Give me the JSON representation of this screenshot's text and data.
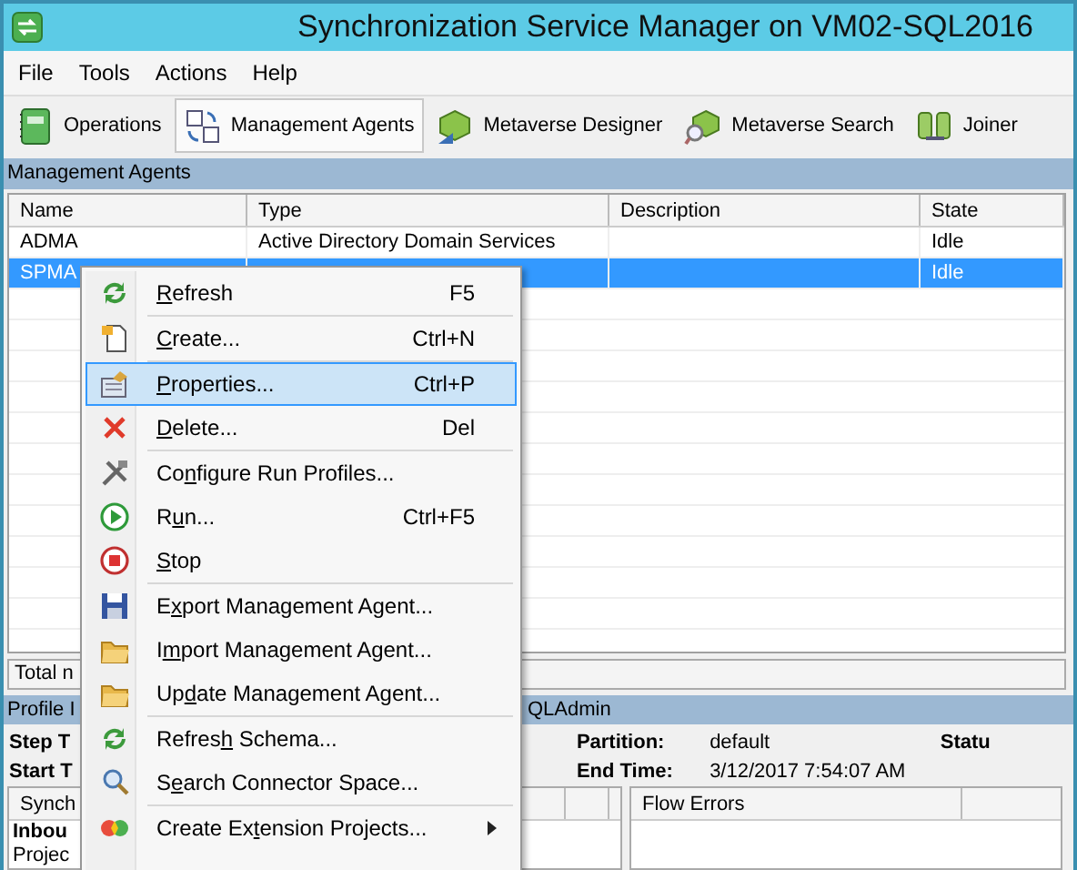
{
  "window": {
    "title": "Synchronization Service Manager on VM02-SQL2016"
  },
  "menu_bar": [
    {
      "label": "File"
    },
    {
      "label": "Tools"
    },
    {
      "label": "Actions"
    },
    {
      "label": "Help"
    }
  ],
  "toolbar": [
    {
      "kind": "operations",
      "label": "Operations",
      "selected": false
    },
    {
      "kind": "agents",
      "label": "Management Agents",
      "selected": true
    },
    {
      "kind": "designer",
      "label": "Metaverse Designer",
      "selected": false
    },
    {
      "kind": "search",
      "label": "Metaverse Search",
      "selected": false
    },
    {
      "kind": "joiner",
      "label": "Joiner",
      "selected": false
    }
  ],
  "panel_title": "Management Agents",
  "table": {
    "columns": [
      "Name",
      "Type",
      "Description",
      "State"
    ],
    "rows": [
      {
        "name": "ADMA",
        "type": "Active Directory Domain Services",
        "state": "Idle",
        "selected": false
      },
      {
        "name": "SPMA",
        "state": "Idle",
        "selected": true
      }
    ]
  },
  "status_text": "Total n",
  "profile_bar": {
    "left": "Profile I",
    "right": "QLAdmin"
  },
  "details": {
    "step_label": "Step T",
    "start_label": "Start T",
    "partition_label": "Partition:",
    "partition": "default",
    "end_time_label": "End Time:",
    "end_time": "3/12/2017 7:54:07 AM",
    "status_label": "Statu"
  },
  "sync_grid": {
    "column": "Synch",
    "rows": [
      {
        "text": "Inbou",
        "bold": true
      },
      {
        "text": "Projec",
        "bold": false
      }
    ]
  },
  "flow_errors": {
    "column": "Flow Errors"
  },
  "context_menu": {
    "items": [
      {
        "kind": "refresh",
        "key": "R",
        "after": "efresh",
        "shortcut": "F5",
        "selected": false,
        "separator_after": true
      },
      {
        "kind": "create",
        "key": "C",
        "after": "reate...",
        "shortcut": "Ctrl+N",
        "selected": false,
        "separator_after": true
      },
      {
        "kind": "properties",
        "key": "P",
        "after": "roperties...",
        "shortcut": "Ctrl+P",
        "selected": true,
        "separator_after": false
      },
      {
        "kind": "delete",
        "key": "D",
        "after": "elete...",
        "shortcut": "Del",
        "selected": false,
        "separator_after": true
      },
      {
        "kind": "configure",
        "before": "Co",
        "key": "n",
        "after": "figure Run Profiles...",
        "selected": false,
        "separator_after": false
      },
      {
        "kind": "run",
        "before": "R",
        "key": "u",
        "after": "n...",
        "shortcut": "Ctrl+F5",
        "selected": false,
        "separator_after": false
      },
      {
        "kind": "stop",
        "key": "S",
        "after": "top",
        "selected": false,
        "separator_after": true
      },
      {
        "kind": "export",
        "before": "E",
        "key": "x",
        "after": "port Management Agent...",
        "selected": false,
        "separator_after": false
      },
      {
        "kind": "import",
        "before": "I",
        "key": "m",
        "after": "port Management Agent...",
        "selected": false,
        "separator_after": false
      },
      {
        "kind": "update",
        "before": "Up",
        "key": "d",
        "after": "ate Management Agent...",
        "selected": false,
        "separator_after": true
      },
      {
        "kind": "refresh",
        "before": "Refres",
        "key": "h",
        "after": " Schema...",
        "selected": false,
        "separator_after": false
      },
      {
        "kind": "search",
        "before": "S",
        "key": "e",
        "after": "arch Connector Space...",
        "selected": false,
        "separator_after": true
      },
      {
        "kind": "extension",
        "before": "Create Ex",
        "key": "t",
        "after": "ension Projects...",
        "selected": false,
        "separator_after": false,
        "submenu": true
      }
    ]
  }
}
